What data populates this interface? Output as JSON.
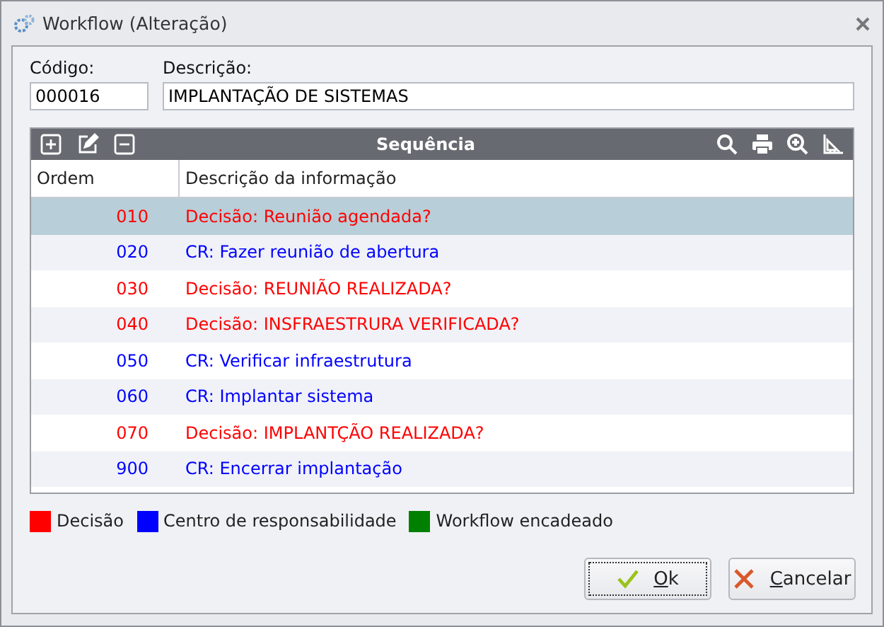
{
  "window": {
    "title": "Workflow (Alteração)"
  },
  "fields": [
    {
      "label": "Código:",
      "value": "000016"
    },
    {
      "label": "Descrição:",
      "value": "IMPLANTAÇÃO DE SISTEMAS"
    }
  ],
  "grid": {
    "title": "Sequência",
    "columns": [
      "Ordem",
      "Descrição da informação"
    ],
    "rows": [
      {
        "ordem": "010",
        "descricao": "Decisão: Reunião agendada?",
        "color": "#ff0000",
        "selected": true
      },
      {
        "ordem": "020",
        "descricao": "CR: Fazer reunião de abertura",
        "color": "#0000ff",
        "selected": false
      },
      {
        "ordem": "030",
        "descricao": "Decisão: REUNIÃO REALIZADA?",
        "color": "#ff0000",
        "selected": false
      },
      {
        "ordem": "040",
        "descricao": "Decisão: INSFRAESTRURA VERIFICADA?",
        "color": "#ff0000",
        "selected": false
      },
      {
        "ordem": "050",
        "descricao": "CR: Verificar infraestrutura",
        "color": "#0000ff",
        "selected": false
      },
      {
        "ordem": "060",
        "descricao": "CR: Implantar sistema",
        "color": "#0000ff",
        "selected": false
      },
      {
        "ordem": "070",
        "descricao": "Decisão: IMPLANTÇÃO REALIZADA?",
        "color": "#ff0000",
        "selected": false
      },
      {
        "ordem": "900",
        "descricao": "CR: Encerrar implantação",
        "color": "#0000ff",
        "selected": false
      }
    ]
  },
  "legend": [
    {
      "label": "Decisão",
      "color": "#ff0000"
    },
    {
      "label": "Centro de responsabilidade",
      "color": "#0000ff"
    },
    {
      "label": "Workflow encadeado",
      "color": "#008000"
    }
  ],
  "buttons": [
    {
      "label": "Ok",
      "kind": "ok"
    },
    {
      "label": "Cancelar",
      "kind": "cancel"
    }
  ]
}
